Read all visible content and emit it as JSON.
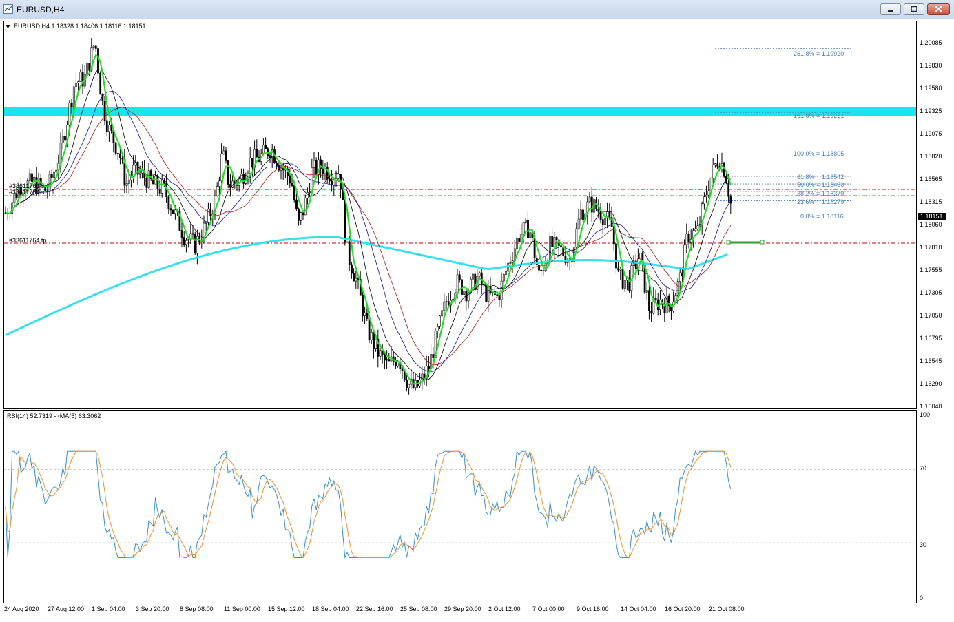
{
  "window": {
    "title": "EURUSD,H4",
    "icons": {
      "app": "chart-window-icon",
      "minimize": "minimize-icon",
      "maximize": "maximize-icon",
      "close": "close-icon"
    }
  },
  "main_chart": {
    "header": "EURUSD,H4  1.18328 1.18406 1.18116 1.18151",
    "price_axis": [
      "1.20085",
      "1.19830",
      "1.19580",
      "1.19325",
      "1.19075",
      "1.18820",
      "1.18565",
      "1.18315",
      "1.18060",
      "1.17810",
      "1.17555",
      "1.17305",
      "1.17050",
      "1.16795",
      "1.16545",
      "1.16290",
      "1.16040"
    ],
    "current_price": "1.18151",
    "fibonacci": [
      {
        "label": "261.8% = 1.19920"
      },
      {
        "label": "161.8% = 1.19231"
      },
      {
        "label": "100.0% = 1.18805"
      },
      {
        "label": "61.8% = 1.18542"
      },
      {
        "label": "50.0% = 1.18460"
      },
      {
        "label": "38.2% = 1.18379"
      },
      {
        "label": "23.6% = 1.18279"
      },
      {
        "label": "0.0% = 1.18116"
      }
    ],
    "orders": {
      "sl": "#33611764 sl",
      "entry": "#33611764 s 1.1",
      "tp": "#33611764 tp"
    },
    "colors": {
      "resistance_zone": "#1ce3f2",
      "ma_fast": "#22dd22",
      "ma_long": "#37e0ec",
      "order_lines": "#cc0000",
      "entry_line": "#2e9e2e",
      "fib": "#4a7fb5"
    }
  },
  "rsi": {
    "header": "RSI(14) 52.7319  ->MA(5) 63.3062",
    "axis": [
      "100",
      "70",
      "30",
      "0"
    ],
    "colors": {
      "rsi": "#3a8fd0",
      "ma": "#f0902a"
    }
  },
  "time_axis": [
    "24 Aug 2020",
    "27 Aug 12:00",
    "1 Sep 04:00",
    "3 Sep 20:00",
    "8 Sep 08:00",
    "11 Sep 00:00",
    "15 Sep 12:00",
    "18 Sep 04:00",
    "22 Sep 16:00",
    "25 Sep 08:00",
    "29 Sep 20:00",
    "2 Oct 12:00",
    "7 Oct 00:00",
    "9 Oct 16:00",
    "14 Oct 04:00",
    "16 Oct 20:00",
    "21 Oct 08:00"
  ],
  "chart_data": {
    "type": "candlestick",
    "symbol": "EURUSD",
    "timeframe": "H4",
    "ylim": [
      1.1604,
      1.2022
    ],
    "close_path": [
      [
        0,
        1.1815
      ],
      [
        20,
        1.1842
      ],
      [
        40,
        1.1848
      ],
      [
        60,
        1.1838
      ],
      [
        80,
        1.188
      ],
      [
        100,
        1.1955
      ],
      [
        115,
        1.196
      ],
      [
        130,
        1.2
      ],
      [
        140,
        1.1935
      ],
      [
        150,
        1.1905
      ],
      [
        165,
        1.188
      ],
      [
        175,
        1.1845
      ],
      [
        185,
        1.186
      ],
      [
        200,
        1.1855
      ],
      [
        215,
        1.1845
      ],
      [
        230,
        1.184
      ],
      [
        245,
        1.1815
      ],
      [
        260,
        1.179
      ],
      [
        275,
        1.178
      ],
      [
        290,
        1.18
      ],
      [
        305,
        1.183
      ],
      [
        315,
        1.188
      ],
      [
        325,
        1.1845
      ],
      [
        340,
        1.185
      ],
      [
        355,
        1.187
      ],
      [
        370,
        1.1875
      ],
      [
        385,
        1.1885
      ],
      [
        400,
        1.1865
      ],
      [
        415,
        1.185
      ],
      [
        425,
        1.18
      ],
      [
        435,
        1.1825
      ],
      [
        445,
        1.186
      ],
      [
        460,
        1.1865
      ],
      [
        475,
        1.1855
      ],
      [
        485,
        1.186
      ],
      [
        495,
        1.1775
      ],
      [
        510,
        1.174
      ],
      [
        525,
        1.169
      ],
      [
        540,
        1.1665
      ],
      [
        555,
        1.165
      ],
      [
        570,
        1.166
      ],
      [
        585,
        1.163
      ],
      [
        595,
        1.1625
      ],
      [
        605,
        1.1635
      ],
      [
        615,
        1.165
      ],
      [
        625,
        1.168
      ],
      [
        640,
        1.172
      ],
      [
        655,
        1.174
      ],
      [
        670,
        1.173
      ],
      [
        685,
        1.1745
      ],
      [
        700,
        1.1725
      ],
      [
        715,
        1.1725
      ],
      [
        730,
        1.176
      ],
      [
        745,
        1.179
      ],
      [
        760,
        1.18
      ],
      [
        775,
        1.1745
      ],
      [
        790,
        1.178
      ],
      [
        805,
        1.1775
      ],
      [
        820,
        1.1765
      ],
      [
        835,
        1.1815
      ],
      [
        850,
        1.1825
      ],
      [
        865,
        1.1815
      ],
      [
        880,
        1.18
      ],
      [
        890,
        1.1745
      ],
      [
        905,
        1.174
      ],
      [
        920,
        1.177
      ],
      [
        935,
        1.171
      ],
      [
        950,
        1.172
      ],
      [
        965,
        1.1715
      ],
      [
        980,
        1.1745
      ],
      [
        990,
        1.179
      ],
      [
        1005,
        1.1795
      ],
      [
        1020,
        1.1845
      ],
      [
        1035,
        1.1875
      ],
      [
        1045,
        1.186
      ],
      [
        1055,
        1.1815
      ]
    ]
  }
}
